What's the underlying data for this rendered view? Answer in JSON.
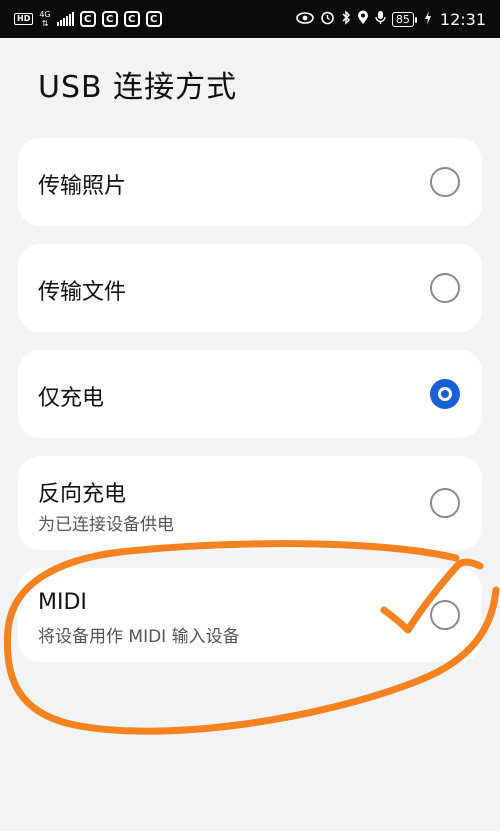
{
  "status_bar": {
    "hd_label": "HD",
    "net_label": "4G",
    "battery": "85",
    "time": "12:31",
    "icons": [
      "hd-icon",
      "signal-icon",
      "app-notification-icon",
      "eye-comfort-icon",
      "alarm-icon",
      "bluetooth-icon",
      "location-icon",
      "microphone-icon",
      "battery-icon",
      "charging-icon"
    ]
  },
  "header": {
    "title": "USB 连接方式"
  },
  "options": [
    {
      "title": "传输照片",
      "subtitle": "",
      "selected": false
    },
    {
      "title": "传输文件",
      "subtitle": "",
      "selected": false
    },
    {
      "title": "仅充电",
      "subtitle": "",
      "selected": true
    },
    {
      "title": "反向充电",
      "subtitle": "为已连接设备供电",
      "selected": false
    },
    {
      "title": "MIDI",
      "subtitle": "将设备用作 MIDI 输入设备",
      "selected": false
    }
  ],
  "colors": {
    "accent": "#1a5fd6",
    "annotation": "#f5821f",
    "card": "#ffffff",
    "background": "#f1f3f5"
  }
}
